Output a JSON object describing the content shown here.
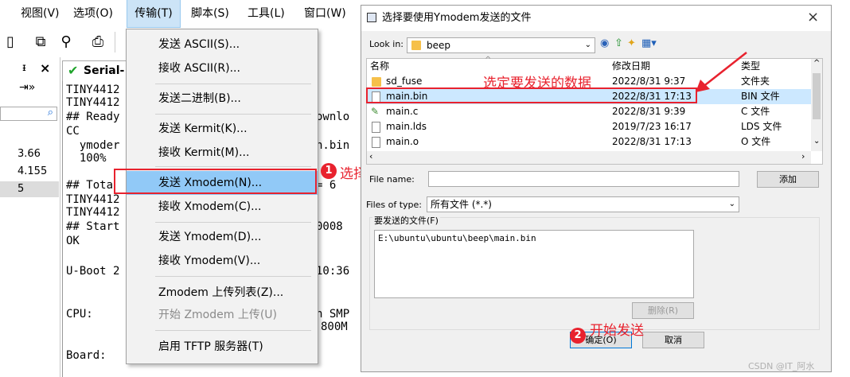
{
  "terminal_app": {
    "menu": [
      "视图(V)",
      "选项(O)",
      "传输(T)",
      "脚本(S)",
      "工具(L)",
      "窗口(W)"
    ],
    "active_menu_index": 2,
    "panel_header": {
      "pin": "ᵻ",
      "close": "×"
    },
    "session_tab_label": "Serial-",
    "session_list_values": [
      "3.66",
      "4.155",
      "5"
    ],
    "terminal_lines": [
      "TINY4412",
      "TINY4412",
      "## Ready",
      "CC",
      "  ymoder",
      "  100%",
      "",
      "## Tota",
      "TINY4412",
      "TINY4412",
      "## Start",
      "OK",
      "",
      "U-Boot 2",
      "",
      "",
      "CPU:",
      "",
      "",
      "Board:"
    ],
    "terminal_right_fragments": [
      "ownlo",
      "n.bin",
      "= 6",
      "0008",
      "10:36",
      "n SMP",
      "800M"
    ],
    "transfer_menu": {
      "items": [
        {
          "label": "发送 ASCII(S)...",
          "enabled": true
        },
        {
          "label": "接收 ASCII(R)...",
          "enabled": true
        },
        {
          "label": "发送二进制(B)...",
          "enabled": true
        },
        {
          "label": "发送 Kermit(K)...",
          "enabled": true
        },
        {
          "label": "接收 Kermit(M)...",
          "enabled": true
        },
        {
          "label": "发送 Xmodem(N)...",
          "enabled": true,
          "highlighted": true
        },
        {
          "label": "接收 Xmodem(C)...",
          "enabled": true
        },
        {
          "label": "发送 Ymodem(D)...",
          "enabled": true
        },
        {
          "label": "接收 Ymodem(V)...",
          "enabled": true
        },
        {
          "label": "Zmodem 上传列表(Z)...",
          "enabled": true
        },
        {
          "label": "开始 Zmodem 上传(U)",
          "enabled": false
        },
        {
          "label": "启用 TFTP 服务器(T)",
          "enabled": true
        }
      ]
    }
  },
  "dialog": {
    "title": "选择要使用Ymodem发送的文件",
    "close_glyph": "×",
    "look_in_label": "Look in:",
    "look_in_value": "beep",
    "columns": [
      "名称",
      "修改日期",
      "类型"
    ],
    "files": [
      {
        "name": "sd_fuse",
        "date": "2022/8/31 9:37",
        "type": "文件夹",
        "icon": "folder-icon"
      },
      {
        "name": "main.bin",
        "date": "2022/8/31 17:13",
        "type": "BIN 文件",
        "icon": "file-icon",
        "selected": true
      },
      {
        "name": "main.c",
        "date": "2022/8/31 9:39",
        "type": "C 文件",
        "icon": "c-source-icon"
      },
      {
        "name": "main.lds",
        "date": "2019/7/23 16:17",
        "type": "LDS 文件",
        "icon": "file-icon"
      },
      {
        "name": "main.o",
        "date": "2022/8/31 17:13",
        "type": "O 文件",
        "icon": "file-icon"
      }
    ],
    "file_name_label": "File name:",
    "file_name_value": "",
    "add_button": "添加",
    "files_of_type_label": "Files of type:",
    "files_of_type_value": "所有文件 (*.*)",
    "group_label": "要发送的文件(F)",
    "file_to_send": "E:\\ubuntu\\ubuntu\\beep\\main.bin",
    "delete_button": "删除(R)",
    "ok_button": "确定(O)",
    "cancel_button": "取消"
  },
  "annotations": {
    "step1_badge": "1",
    "step1_text": "选择发送协议",
    "select_data_text": "选定要发送的数据",
    "step2_badge": "2",
    "step2_text": "开始发送"
  },
  "watermark": "CSDN @IT_阿水",
  "accent_color": "#e8222e",
  "highlight_color": "#91c9f7"
}
